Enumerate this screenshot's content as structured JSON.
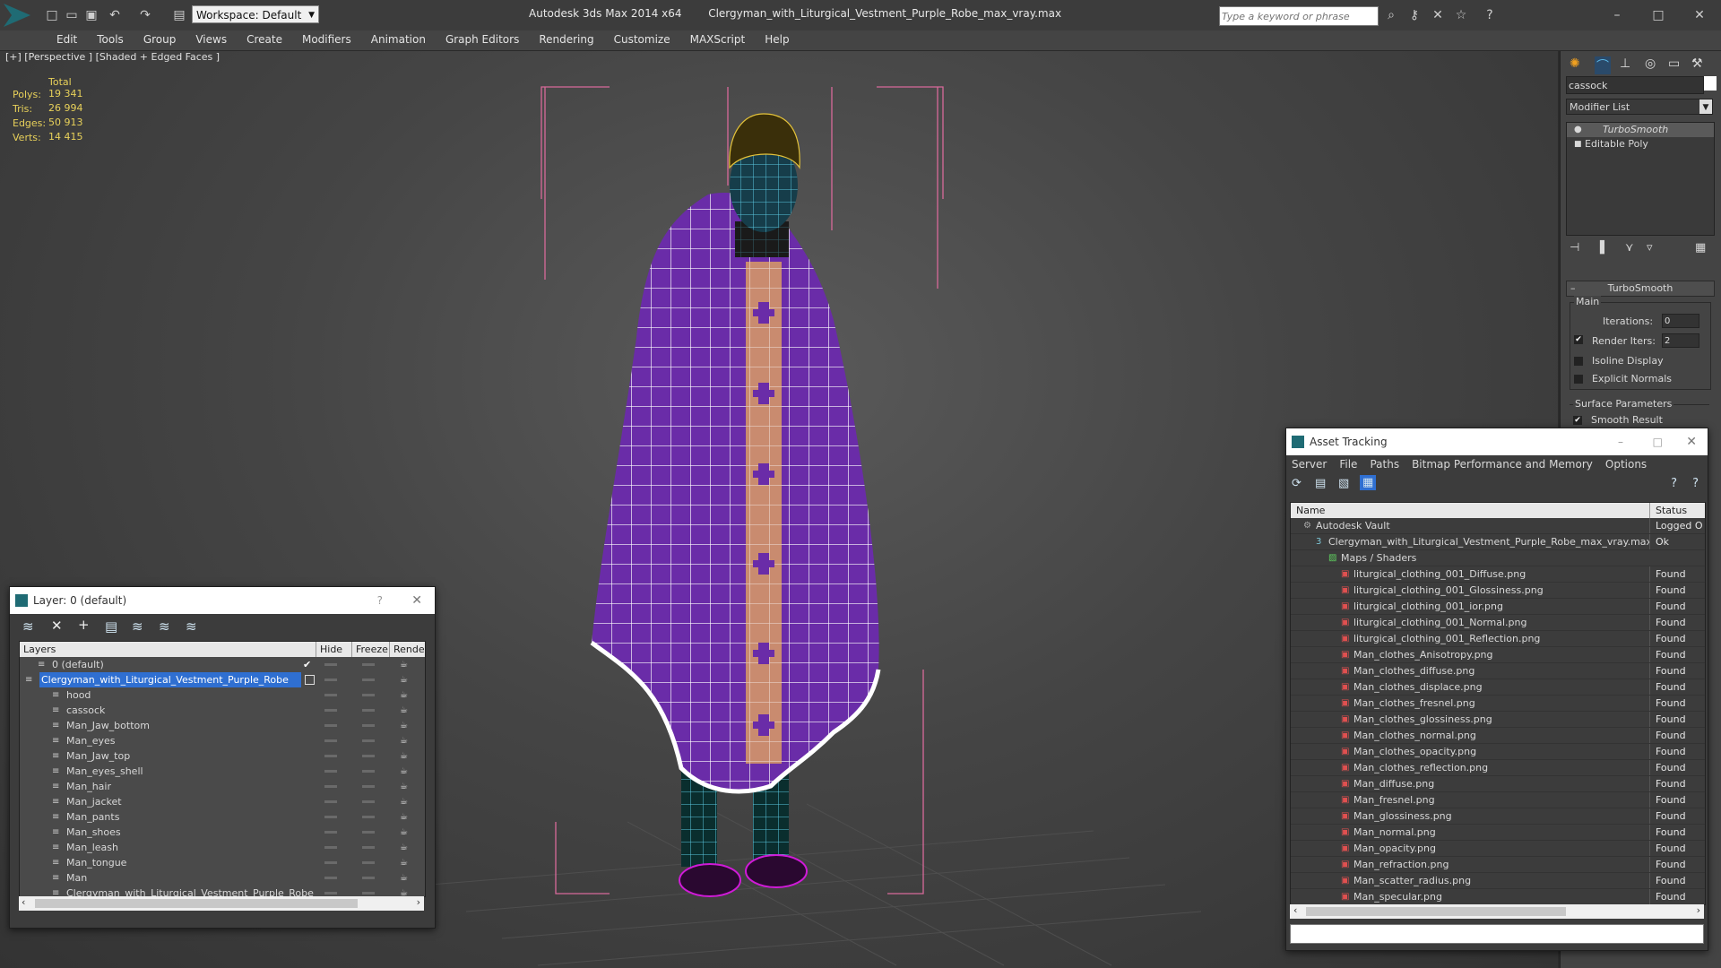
{
  "app": {
    "title": "Autodesk 3ds Max  2014 x64",
    "file": "Clergyman_with_Liturgical_Vestment_Purple_Robe_max_vray.max",
    "workspace": "Workspace: Default",
    "search_placeholder": "Type a keyword or phrase"
  },
  "menu": [
    "Edit",
    "Tools",
    "Group",
    "Views",
    "Create",
    "Modifiers",
    "Animation",
    "Graph Editors",
    "Rendering",
    "Customize",
    "MAXScript",
    "Help"
  ],
  "viewport": {
    "label": "[+] [Perspective ] [Shaded + Edged Faces ]",
    "stats_header": "Total",
    "stats": [
      {
        "label": "Polys:",
        "value": "19 341"
      },
      {
        "label": "Tris:",
        "value": "26 994"
      },
      {
        "label": "Edges:",
        "value": "50 913"
      },
      {
        "label": "Verts:",
        "value": "14 415"
      }
    ]
  },
  "command_panel": {
    "object_name": "cassock",
    "modifier_list": "Modifier List",
    "stack": [
      "TurboSmooth",
      "Editable Poly"
    ],
    "rollout_title": "TurboSmooth",
    "main_group": "Main",
    "iterations_label": "Iterations:",
    "iterations_value": "0",
    "render_iters_label": "Render Iters:",
    "render_iters_value": "2",
    "isoline_label": "Isoline Display",
    "explicit_label": "Explicit Normals",
    "surface_group": "Surface Parameters",
    "smooth_label": "Smooth Result"
  },
  "layer_window": {
    "title": "Layer: 0 (default)",
    "columns": {
      "layers": "Layers",
      "hide": "Hide",
      "freeze": "Freeze",
      "render": "Render"
    },
    "rows": [
      {
        "name": "0 (default)",
        "indent": 1,
        "active": true,
        "selected": false
      },
      {
        "name": "Clergyman_with_Liturgical_Vestment_Purple_Robe",
        "indent": 0,
        "active": false,
        "selected": true
      },
      {
        "name": "hood",
        "indent": 2
      },
      {
        "name": "cassock",
        "indent": 2
      },
      {
        "name": "Man_Jaw_bottom",
        "indent": 2
      },
      {
        "name": "Man_eyes",
        "indent": 2
      },
      {
        "name": "Man_Jaw_top",
        "indent": 2
      },
      {
        "name": "Man_eyes_shell",
        "indent": 2
      },
      {
        "name": "Man_hair",
        "indent": 2
      },
      {
        "name": "Man_jacket",
        "indent": 2
      },
      {
        "name": "Man_pants",
        "indent": 2
      },
      {
        "name": "Man_shoes",
        "indent": 2
      },
      {
        "name": "Man_leash",
        "indent": 2
      },
      {
        "name": "Man_tongue",
        "indent": 2
      },
      {
        "name": "Man",
        "indent": 2
      },
      {
        "name": "Clergyman_with_Liturgical_Vestment_Purple_Robe",
        "indent": 2
      }
    ]
  },
  "asset_window": {
    "title": "Asset Tracking",
    "menu": [
      "Server",
      "File",
      "Paths",
      "Bitmap Performance and Memory",
      "Options"
    ],
    "columns": {
      "name": "Name",
      "status": "Status"
    },
    "rows": [
      {
        "name": "Autodesk Vault",
        "status": "Logged O",
        "indent": 1,
        "kind": "vault"
      },
      {
        "name": "Clergyman_with_Liturgical_Vestment_Purple_Robe_max_vray.max",
        "status": "Ok",
        "indent": 2,
        "kind": "max"
      },
      {
        "name": "Maps / Shaders",
        "status": "",
        "indent": 3,
        "kind": "folder"
      },
      {
        "name": "liturgical_clothing_001_Diffuse.png",
        "status": "Found",
        "indent": 4,
        "kind": "png"
      },
      {
        "name": "liturgical_clothing_001_Glossiness.png",
        "status": "Found",
        "indent": 4,
        "kind": "png"
      },
      {
        "name": "liturgical_clothing_001_ior.png",
        "status": "Found",
        "indent": 4,
        "kind": "png"
      },
      {
        "name": "liturgical_clothing_001_Normal.png",
        "status": "Found",
        "indent": 4,
        "kind": "png"
      },
      {
        "name": "liturgical_clothing_001_Reflection.png",
        "status": "Found",
        "indent": 4,
        "kind": "png"
      },
      {
        "name": "Man_clothes_Anisotropy.png",
        "status": "Found",
        "indent": 4,
        "kind": "png"
      },
      {
        "name": "Man_clothes_diffuse.png",
        "status": "Found",
        "indent": 4,
        "kind": "png"
      },
      {
        "name": "Man_clothes_displace.png",
        "status": "Found",
        "indent": 4,
        "kind": "png"
      },
      {
        "name": "Man_clothes_fresnel.png",
        "status": "Found",
        "indent": 4,
        "kind": "png"
      },
      {
        "name": "Man_clothes_glossiness.png",
        "status": "Found",
        "indent": 4,
        "kind": "png"
      },
      {
        "name": "Man_clothes_normal.png",
        "status": "Found",
        "indent": 4,
        "kind": "png"
      },
      {
        "name": "Man_clothes_opacity.png",
        "status": "Found",
        "indent": 4,
        "kind": "png"
      },
      {
        "name": "Man_clothes_reflection.png",
        "status": "Found",
        "indent": 4,
        "kind": "png"
      },
      {
        "name": "Man_diffuse.png",
        "status": "Found",
        "indent": 4,
        "kind": "png"
      },
      {
        "name": "Man_fresnel.png",
        "status": "Found",
        "indent": 4,
        "kind": "png"
      },
      {
        "name": "Man_glossiness.png",
        "status": "Found",
        "indent": 4,
        "kind": "png"
      },
      {
        "name": "Man_normal.png",
        "status": "Found",
        "indent": 4,
        "kind": "png"
      },
      {
        "name": "Man_opacity.png",
        "status": "Found",
        "indent": 4,
        "kind": "png"
      },
      {
        "name": "Man_refraction.png",
        "status": "Found",
        "indent": 4,
        "kind": "png"
      },
      {
        "name": "Man_scatter_radius.png",
        "status": "Found",
        "indent": 4,
        "kind": "png"
      },
      {
        "name": "Man_specular.png",
        "status": "Found",
        "indent": 4,
        "kind": "png"
      }
    ]
  },
  "colors": {
    "robe": "#6a2ca8",
    "stole": "#c98b6f",
    "wire": "#ffffff",
    "bbox": "#d86a9a",
    "selection": "#2f6fd1"
  }
}
